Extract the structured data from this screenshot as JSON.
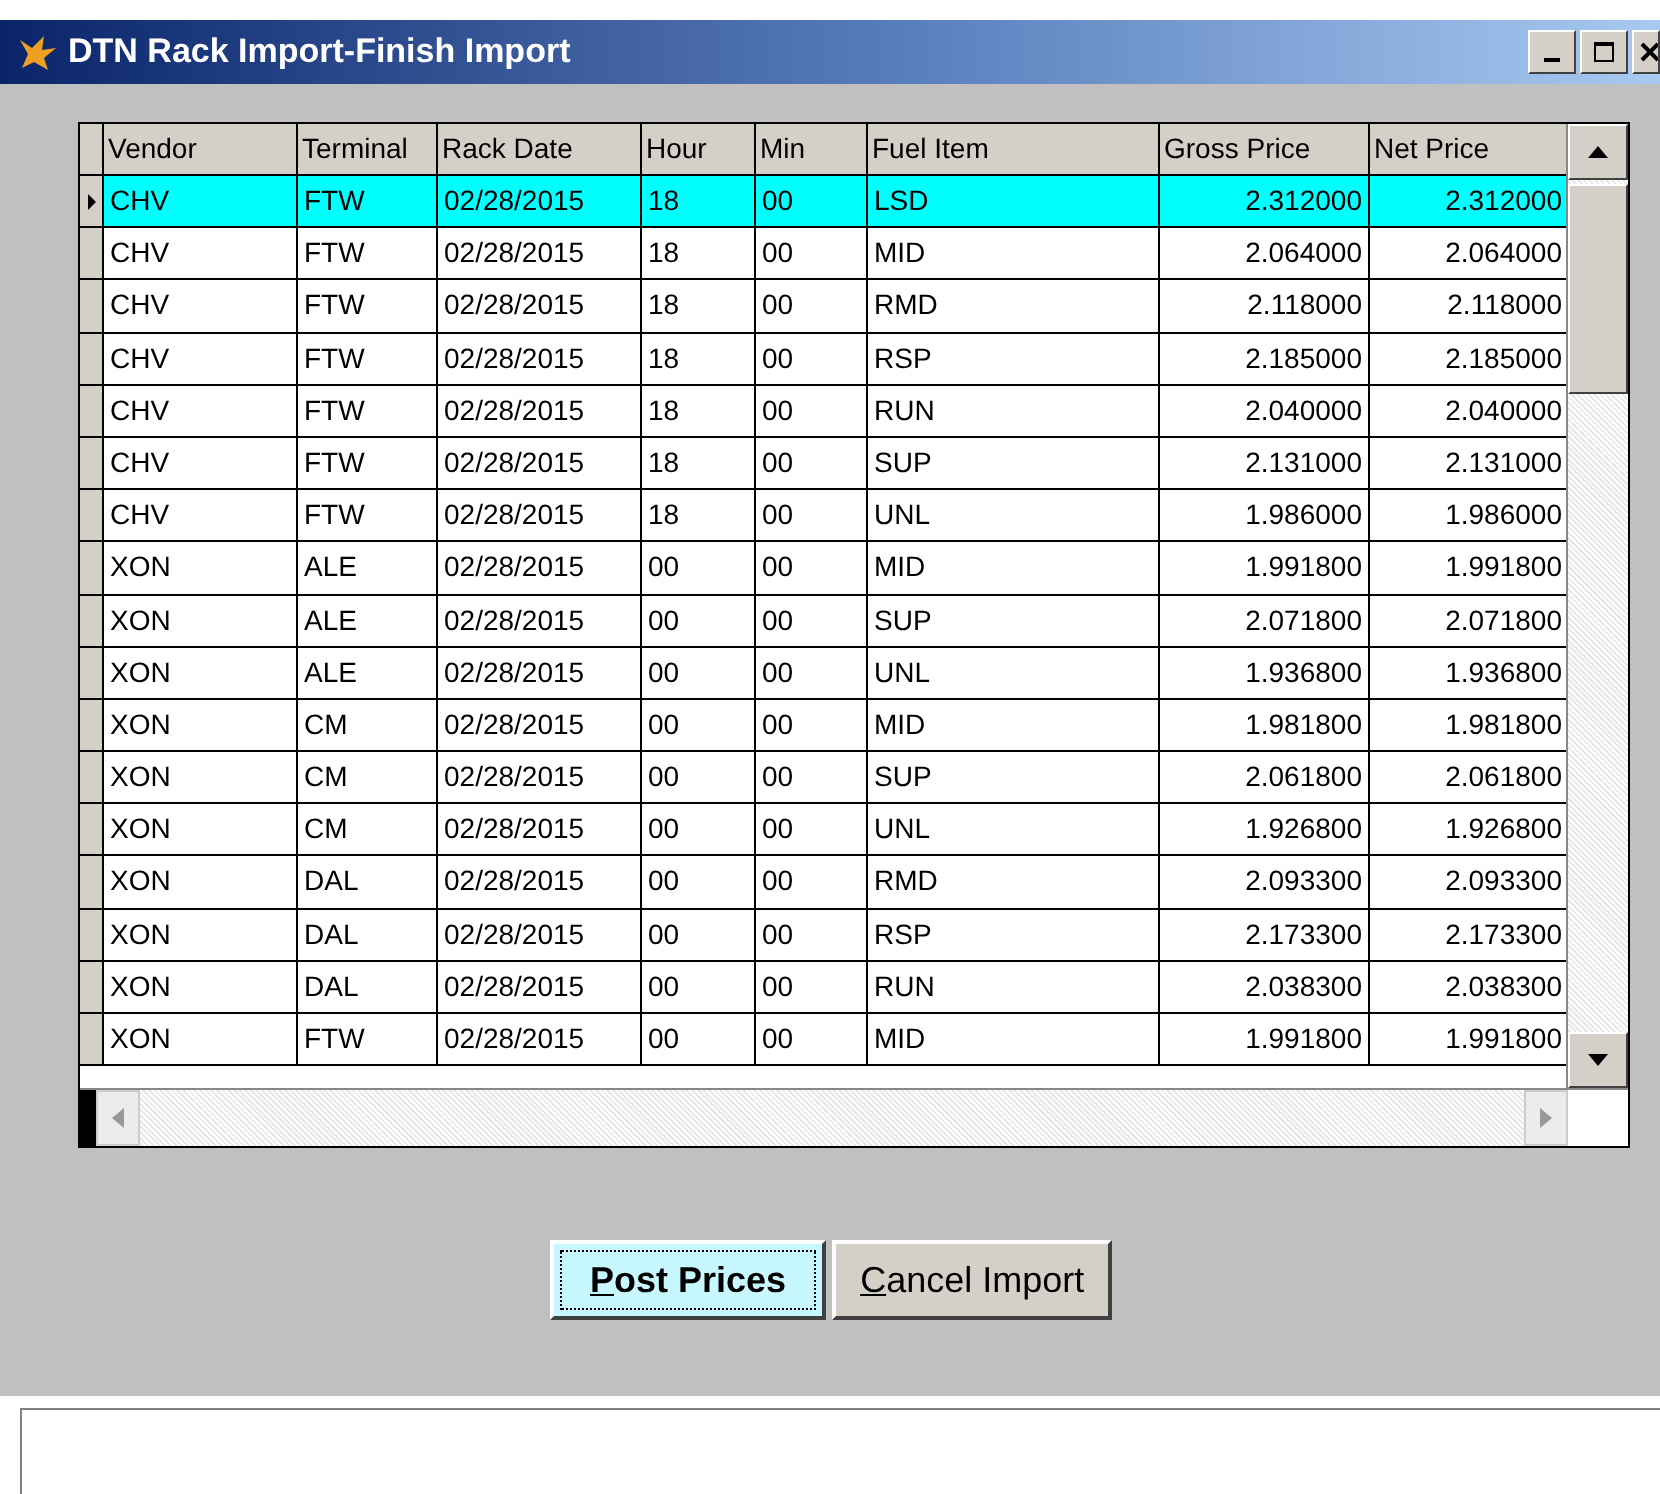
{
  "window": {
    "title": "DTN Rack Import-Finish Import"
  },
  "table": {
    "columns": [
      "Vendor",
      "Terminal",
      "Rack Date",
      "Hour",
      "Min",
      "Fuel Item",
      "Gross Price",
      "Net Price"
    ],
    "rows": [
      {
        "cells": [
          "CHV",
          "FTW",
          "02/28/2015",
          "18",
          "00",
          "LSD",
          "2.312000",
          "2.312000"
        ],
        "selected": true
      },
      {
        "cells": [
          "CHV",
          "FTW",
          "02/28/2015",
          "18",
          "00",
          "MID",
          "2.064000",
          "2.064000"
        ],
        "selected": false
      },
      {
        "cells": [
          "CHV",
          "FTW",
          "02/28/2015",
          "18",
          "00",
          "RMD",
          "2.118000",
          "2.118000"
        ],
        "selected": false
      },
      {
        "cells": [
          "CHV",
          "FTW",
          "02/28/2015",
          "18",
          "00",
          "RSP",
          "2.185000",
          "2.185000"
        ],
        "selected": false
      },
      {
        "cells": [
          "CHV",
          "FTW",
          "02/28/2015",
          "18",
          "00",
          "RUN",
          "2.040000",
          "2.040000"
        ],
        "selected": false
      },
      {
        "cells": [
          "CHV",
          "FTW",
          "02/28/2015",
          "18",
          "00",
          "SUP",
          "2.131000",
          "2.131000"
        ],
        "selected": false
      },
      {
        "cells": [
          "CHV",
          "FTW",
          "02/28/2015",
          "18",
          "00",
          "UNL",
          "1.986000",
          "1.986000"
        ],
        "selected": false
      },
      {
        "cells": [
          "XON",
          "ALE",
          "02/28/2015",
          "00",
          "00",
          "MID",
          "1.991800",
          "1.991800"
        ],
        "selected": false
      },
      {
        "cells": [
          "XON",
          "ALE",
          "02/28/2015",
          "00",
          "00",
          "SUP",
          "2.071800",
          "2.071800"
        ],
        "selected": false
      },
      {
        "cells": [
          "XON",
          "ALE",
          "02/28/2015",
          "00",
          "00",
          "UNL",
          "1.936800",
          "1.936800"
        ],
        "selected": false
      },
      {
        "cells": [
          "XON",
          "CM",
          "02/28/2015",
          "00",
          "00",
          "MID",
          "1.981800",
          "1.981800"
        ],
        "selected": false
      },
      {
        "cells": [
          "XON",
          "CM",
          "02/28/2015",
          "00",
          "00",
          "SUP",
          "2.061800",
          "2.061800"
        ],
        "selected": false
      },
      {
        "cells": [
          "XON",
          "CM",
          "02/28/2015",
          "00",
          "00",
          "UNL",
          "1.926800",
          "1.926800"
        ],
        "selected": false
      },
      {
        "cells": [
          "XON",
          "DAL",
          "02/28/2015",
          "00",
          "00",
          "RMD",
          "2.093300",
          "2.093300"
        ],
        "selected": false
      },
      {
        "cells": [
          "XON",
          "DAL",
          "02/28/2015",
          "00",
          "00",
          "RSP",
          "2.173300",
          "2.173300"
        ],
        "selected": false
      },
      {
        "cells": [
          "XON",
          "DAL",
          "02/28/2015",
          "00",
          "00",
          "RUN",
          "2.038300",
          "2.038300"
        ],
        "selected": false
      },
      {
        "cells": [
          "XON",
          "FTW",
          "02/28/2015",
          "00",
          "00",
          "MID",
          "1.991800",
          "1.991800"
        ],
        "selected": false
      }
    ]
  },
  "buttons": [
    {
      "label": "Post Prices",
      "selected": true
    },
    {
      "label": "Cancel Import",
      "selected": false
    }
  ]
}
